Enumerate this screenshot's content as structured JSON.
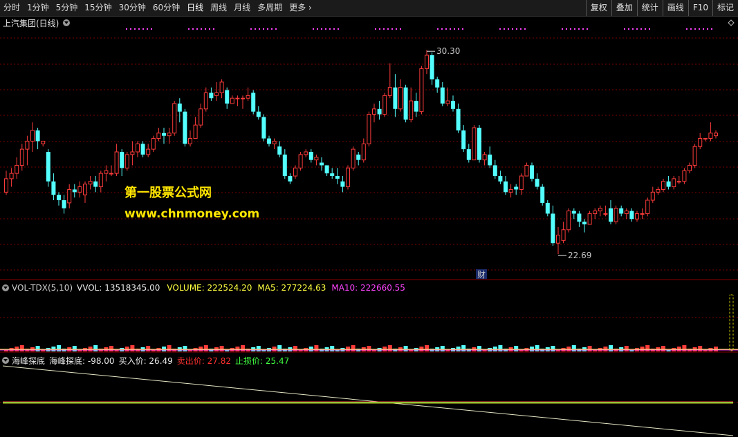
{
  "toolbar": {
    "period_tabs": [
      "分时",
      "1分钟",
      "5分钟",
      "15分钟",
      "30分钟",
      "60分钟",
      "日线",
      "周线",
      "月线",
      "多周期",
      "更多"
    ],
    "active_tab": "日线",
    "right_buttons": [
      "复权",
      "叠加",
      "统计",
      "画线",
      "F10",
      "标记"
    ]
  },
  "main_panel": {
    "title": "上汽集团(日线)",
    "high_label": "30.30",
    "low_label": "22.69",
    "finance_marker": "财",
    "watermark_line1": "第一股票公式网",
    "watermark_line2": "www.chnmoney.com"
  },
  "volume_panel": {
    "indicator": "VOL-TDX(5,10)",
    "vvol": "VVOL: 13518345.00",
    "volume": "VOLUME: 222524.20",
    "ma5": "MA5: 277224.63",
    "ma10": "MA10: 222660.55"
  },
  "indicator_panel": {
    "indicator": "海峰探底",
    "name_value": "海峰探底: -98.00",
    "buy": "买入价: 26.49",
    "sell": "卖出价: 27.82",
    "stop": "止损价: 25.47"
  },
  "colors": {
    "up": "#ff3b3b",
    "down": "#54ffff",
    "grid": "#7a0000",
    "magenta": "#ff44ff",
    "yellow": "#ffff00"
  },
  "chart_data": {
    "type": "candlestick",
    "y_range": [
      22.69,
      30.3
    ],
    "candles": [
      [
        25.0,
        25.8,
        24.9,
        25.5
      ],
      [
        25.5,
        25.9,
        25.2,
        25.7
      ],
      [
        25.7,
        26.3,
        25.5,
        26.0
      ],
      [
        26.0,
        26.8,
        25.8,
        26.6
      ],
      [
        26.6,
        27.1,
        26.0,
        26.9
      ],
      [
        26.9,
        27.6,
        26.5,
        27.3
      ],
      [
        27.3,
        27.4,
        26.6,
        26.9
      ],
      [
        26.8,
        26.9,
        26.7,
        26.9
      ],
      [
        26.5,
        26.6,
        25.2,
        25.4
      ],
      [
        25.4,
        25.7,
        24.7,
        24.9
      ],
      [
        24.9,
        25.0,
        24.5,
        24.7
      ],
      [
        24.7,
        24.9,
        24.2,
        24.4
      ],
      [
        24.6,
        25.3,
        24.4,
        25.1
      ],
      [
        25.1,
        25.3,
        24.8,
        25.0
      ],
      [
        25.0,
        25.4,
        24.8,
        25.2
      ],
      [
        24.9,
        25.4,
        24.6,
        25.3
      ],
      [
        25.3,
        25.6,
        25.1,
        25.4
      ],
      [
        25.4,
        25.6,
        25.0,
        25.2
      ],
      [
        25.2,
        25.8,
        25.0,
        25.7
      ],
      [
        25.7,
        26.0,
        25.4,
        25.8
      ],
      [
        25.7,
        26.0,
        25.6,
        25.7
      ],
      [
        25.7,
        26.8,
        25.6,
        26.5
      ],
      [
        26.5,
        26.6,
        25.6,
        25.9
      ],
      [
        25.9,
        26.5,
        25.8,
        26.4
      ],
      [
        26.4,
        26.9,
        26.0,
        26.5
      ],
      [
        26.5,
        26.9,
        26.3,
        26.8
      ],
      [
        26.8,
        26.9,
        26.3,
        26.4
      ],
      [
        26.4,
        26.8,
        26.3,
        26.6
      ],
      [
        26.6,
        27.1,
        26.5,
        27.0
      ],
      [
        27.0,
        27.4,
        26.9,
        27.2
      ],
      [
        27.2,
        27.4,
        26.8,
        27.1
      ],
      [
        27.1,
        27.4,
        26.8,
        27.2
      ],
      [
        27.2,
        28.4,
        27.1,
        28.3
      ],
      [
        28.3,
        28.5,
        27.6,
        28.0
      ],
      [
        28.0,
        28.1,
        26.7,
        26.8
      ],
      [
        26.8,
        27.3,
        26.7,
        27.0
      ],
      [
        27.0,
        27.8,
        27.0,
        27.5
      ],
      [
        27.5,
        28.3,
        27.4,
        28.1
      ],
      [
        28.1,
        28.9,
        28.0,
        28.7
      ],
      [
        28.7,
        28.9,
        28.4,
        28.5
      ],
      [
        28.6,
        29.1,
        28.4,
        28.7
      ],
      [
        28.7,
        29.2,
        28.5,
        29.1
      ],
      [
        28.8,
        28.9,
        28.1,
        28.3
      ],
      [
        28.3,
        28.6,
        28.3,
        28.5
      ],
      [
        28.5,
        28.6,
        28.2,
        28.5
      ],
      [
        28.5,
        28.6,
        28.1,
        28.5
      ],
      [
        28.5,
        28.9,
        28.4,
        28.6
      ],
      [
        28.7,
        28.8,
        27.9,
        28.0
      ],
      [
        28.0,
        28.2,
        27.7,
        27.8
      ],
      [
        27.8,
        27.9,
        26.9,
        27.0
      ],
      [
        27.0,
        27.1,
        26.7,
        26.8
      ],
      [
        26.8,
        27.0,
        26.6,
        26.9
      ],
      [
        26.7,
        26.9,
        26.3,
        26.4
      ],
      [
        26.4,
        26.6,
        25.5,
        25.6
      ],
      [
        25.6,
        25.7,
        25.3,
        25.4
      ],
      [
        25.6,
        26.0,
        25.5,
        25.9
      ],
      [
        25.9,
        26.5,
        25.8,
        26.4
      ],
      [
        26.4,
        26.6,
        26.3,
        26.5
      ],
      [
        26.5,
        26.6,
        26.1,
        26.2
      ],
      [
        26.2,
        26.4,
        26.0,
        26.3
      ],
      [
        26.1,
        26.3,
        25.8,
        26.0
      ],
      [
        26.0,
        26.0,
        25.6,
        25.7
      ],
      [
        25.7,
        25.9,
        25.5,
        25.6
      ],
      [
        25.6,
        25.9,
        25.3,
        25.5
      ],
      [
        25.4,
        25.6,
        25.0,
        25.2
      ],
      [
        25.2,
        26.0,
        25.1,
        25.9
      ],
      [
        25.9,
        26.7,
        25.8,
        26.6
      ],
      [
        26.4,
        26.5,
        26.0,
        26.2
      ],
      [
        26.2,
        27.0,
        26.1,
        26.8
      ],
      [
        26.8,
        28.0,
        26.7,
        27.9
      ],
      [
        27.9,
        28.3,
        27.6,
        28.1
      ],
      [
        28.1,
        28.4,
        27.7,
        27.9
      ],
      [
        27.9,
        28.7,
        27.8,
        28.6
      ],
      [
        28.6,
        29.8,
        28.5,
        28.9
      ],
      [
        28.9,
        29.4,
        27.8,
        28.1
      ],
      [
        28.1,
        29.2,
        28.0,
        28.9
      ],
      [
        28.9,
        29.0,
        27.6,
        27.7
      ],
      [
        27.7,
        28.9,
        27.6,
        28.4
      ],
      [
        28.4,
        28.7,
        27.8,
        28.0
      ],
      [
        28.0,
        29.7,
        27.9,
        29.6
      ],
      [
        29.6,
        30.3,
        29.4,
        30.1
      ],
      [
        30.1,
        30.2,
        29.0,
        29.2
      ],
      [
        29.2,
        29.3,
        28.7,
        28.9
      ],
      [
        28.9,
        29.1,
        28.2,
        28.3
      ],
      [
        28.3,
        28.9,
        28.2,
        28.4
      ],
      [
        28.4,
        28.6,
        28.0,
        28.1
      ],
      [
        28.1,
        28.3,
        27.2,
        27.3
      ],
      [
        27.3,
        27.5,
        26.5,
        26.6
      ],
      [
        26.6,
        26.8,
        26.1,
        26.2
      ],
      [
        26.2,
        27.5,
        26.2,
        27.4
      ],
      [
        27.4,
        27.5,
        26.1,
        26.2
      ],
      [
        26.2,
        26.5,
        26.0,
        26.4
      ],
      [
        26.4,
        26.7,
        25.9,
        26.0
      ],
      [
        26.0,
        26.2,
        25.5,
        25.6
      ],
      [
        25.6,
        25.8,
        25.3,
        25.4
      ],
      [
        25.4,
        25.6,
        24.9,
        25.0
      ],
      [
        25.0,
        25.3,
        24.8,
        25.1
      ],
      [
        25.2,
        25.3,
        24.9,
        25.1
      ],
      [
        25.1,
        25.7,
        24.9,
        25.6
      ],
      [
        25.6,
        26.1,
        25.6,
        26.0
      ],
      [
        26.0,
        26.1,
        25.4,
        25.5
      ],
      [
        25.5,
        25.7,
        25.1,
        25.2
      ],
      [
        25.2,
        25.3,
        24.5,
        24.6
      ],
      [
        24.6,
        24.7,
        24.1,
        24.2
      ],
      [
        24.2,
        24.5,
        23.0,
        23.1
      ],
      [
        23.1,
        23.7,
        22.69,
        23.4
      ],
      [
        23.2,
        23.9,
        23.1,
        23.6
      ],
      [
        23.6,
        24.4,
        23.5,
        24.3
      ],
      [
        24.3,
        24.4,
        24.0,
        24.2
      ],
      [
        24.2,
        24.3,
        23.7,
        23.9
      ],
      [
        23.9,
        24.0,
        23.5,
        23.8
      ],
      [
        23.8,
        24.3,
        23.8,
        24.2
      ],
      [
        24.2,
        24.4,
        24.0,
        24.3
      ],
      [
        24.3,
        24.5,
        24.1,
        24.4
      ],
      [
        24.2,
        24.5,
        24.1,
        24.2
      ],
      [
        24.4,
        24.7,
        23.8,
        23.9
      ],
      [
        23.9,
        24.5,
        23.8,
        24.4
      ],
      [
        24.4,
        24.5,
        24.1,
        24.2
      ],
      [
        24.2,
        24.4,
        24.0,
        24.3
      ],
      [
        24.3,
        24.4,
        23.9,
        24.0
      ],
      [
        24.0,
        24.3,
        23.9,
        24.2
      ],
      [
        24.2,
        24.4,
        24.0,
        24.2
      ],
      [
        24.2,
        24.8,
        24.1,
        24.7
      ],
      [
        24.7,
        25.2,
        24.6,
        25.0
      ],
      [
        25.0,
        25.2,
        24.9,
        25.1
      ],
      [
        25.1,
        25.5,
        25.0,
        25.4
      ],
      [
        25.4,
        25.6,
        25.1,
        25.2
      ],
      [
        25.2,
        25.6,
        25.1,
        25.5
      ],
      [
        25.4,
        25.6,
        25.3,
        25.4
      ],
      [
        25.4,
        25.9,
        25.3,
        25.8
      ],
      [
        25.8,
        26.1,
        25.7,
        26.0
      ],
      [
        26.0,
        26.8,
        25.9,
        26.7
      ],
      [
        26.7,
        27.2,
        26.6,
        27.0
      ],
      [
        27.0,
        27.0,
        26.9,
        27.0
      ],
      [
        27.0,
        27.6,
        26.9,
        27.2
      ],
      [
        27.1,
        27.3,
        27.0,
        27.2
      ]
    ],
    "volume_last_bar": 13518345.0,
    "indicator_series": {
      "start": 0.0,
      "end": -98.0
    }
  }
}
